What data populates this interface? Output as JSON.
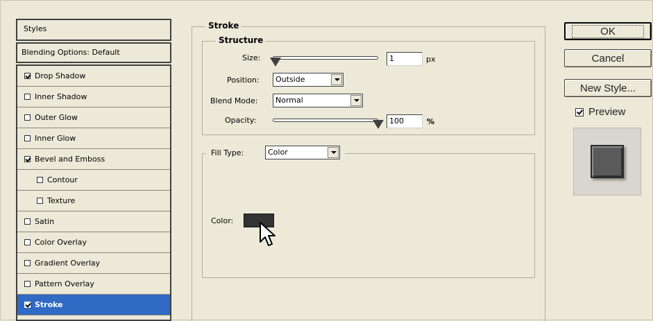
{
  "styles": {
    "header": "Styles",
    "blending_options": "Blending Options: Default",
    "items": [
      {
        "label": "Drop Shadow",
        "checked": true
      },
      {
        "label": "Inner Shadow",
        "checked": false
      },
      {
        "label": "Outer Glow",
        "checked": false
      },
      {
        "label": "Inner Glow",
        "checked": false
      },
      {
        "label": "Bevel and Emboss",
        "checked": true
      },
      {
        "label": "Contour",
        "checked": false
      },
      {
        "label": "Texture",
        "checked": false
      },
      {
        "label": "Satin",
        "checked": false
      },
      {
        "label": "Color Overlay",
        "checked": false
      },
      {
        "label": "Gradient Overlay",
        "checked": false
      },
      {
        "label": "Pattern Overlay",
        "checked": false
      },
      {
        "label": "Stroke",
        "checked": true
      }
    ]
  },
  "stroke": {
    "title": "Stroke",
    "structure": {
      "title": "Structure",
      "size_label": "Size:",
      "size_value": "1",
      "size_unit": "px",
      "position_label": "Position:",
      "position_value": "Outside",
      "blend_mode_label": "Blend Mode:",
      "blend_mode_value": "Normal",
      "opacity_label": "Opacity:",
      "opacity_value": "100",
      "opacity_unit": "%"
    },
    "fill_type_label": "Fill Type:",
    "fill_type_value": "Color",
    "color_label": "Color:",
    "color_value": "#333333"
  },
  "buttons": {
    "ok": "OK",
    "cancel": "Cancel",
    "new_style": "New Style...",
    "preview": "Preview",
    "preview_checked": true
  }
}
